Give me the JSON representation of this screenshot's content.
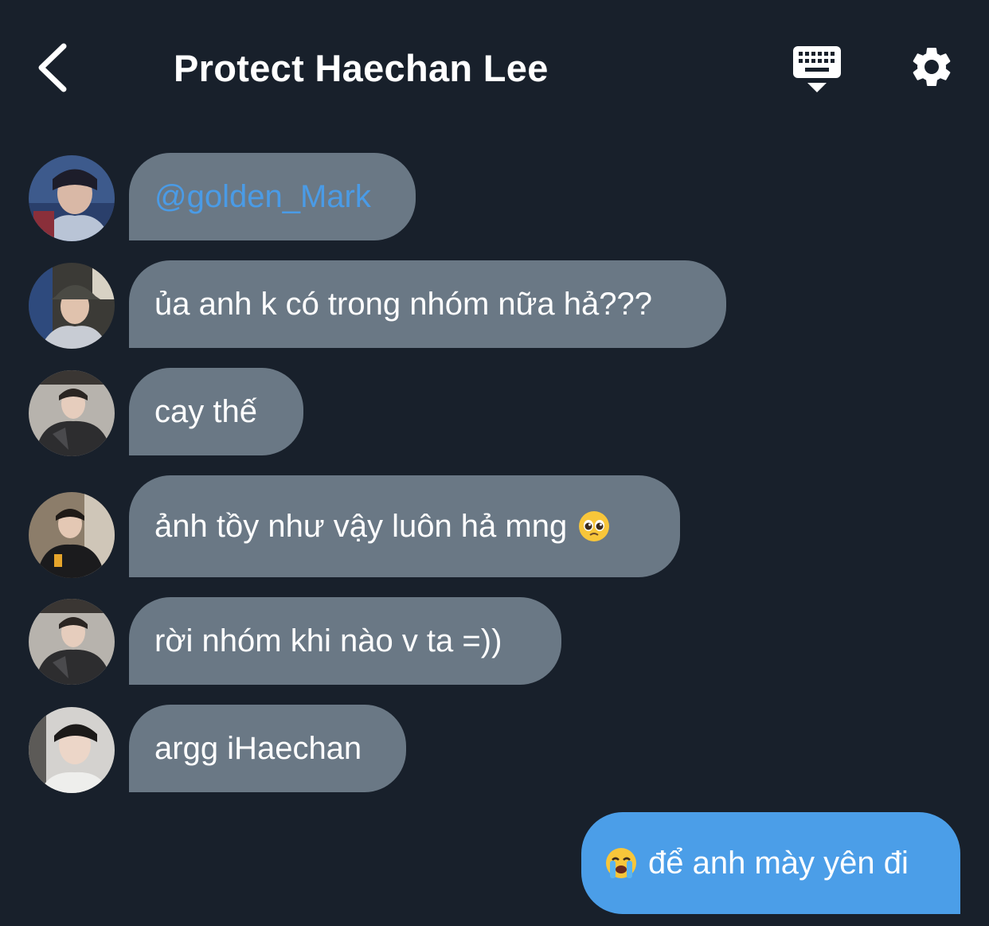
{
  "header": {
    "title": "Protect Haechan Lee",
    "back_icon": "chevron-left-icon",
    "keyboard_icon": "keyboard-hide-icon",
    "settings_icon": "gear-icon"
  },
  "messages": [
    {
      "text": "@golden_Mark",
      "type": "mention"
    },
    {
      "text": "ủa anh k có trong nhóm nữa hả???"
    },
    {
      "text": "cay thế"
    },
    {
      "text": "ảnh tồy như vậy luôn hả mng",
      "emoji": "pleading-face-emoji"
    },
    {
      "text": "rời nhóm khi nào v ta =))"
    },
    {
      "text": "argg iHaechan"
    }
  ],
  "outgoing": [
    {
      "text": "để anh mày yên đi",
      "emoji": "loudly-crying-face-emoji"
    }
  ],
  "colors": {
    "background": "#18202b",
    "incoming_bubble": "#6a7885",
    "outgoing_bubble": "#4b9ee8",
    "mention": "#4a9be6"
  }
}
